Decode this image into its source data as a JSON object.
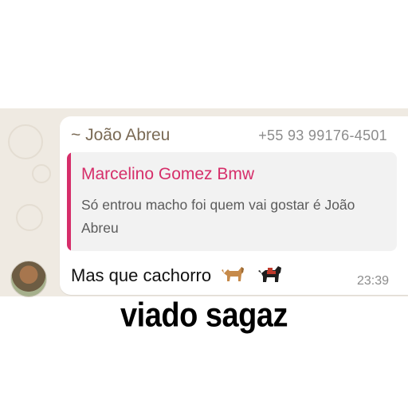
{
  "message": {
    "sender_name": "~ João Abreu",
    "sender_phone": "+55 93 99176-4501",
    "reply": {
      "author": "Marcelino Gomez Bmw",
      "text": "Só entrou macho foi quem vai gostar é João Abreu"
    },
    "text": "Mas que cachorro",
    "emojis": [
      "dog-emoji",
      "service-dog-emoji"
    ],
    "time": "23:39"
  },
  "caption": "viado sagaz",
  "colors": {
    "chat_background": "#efeae2",
    "bubble": "#ffffff",
    "quote_accent": "#d62e6a",
    "sender_name": "#7a6a55"
  }
}
